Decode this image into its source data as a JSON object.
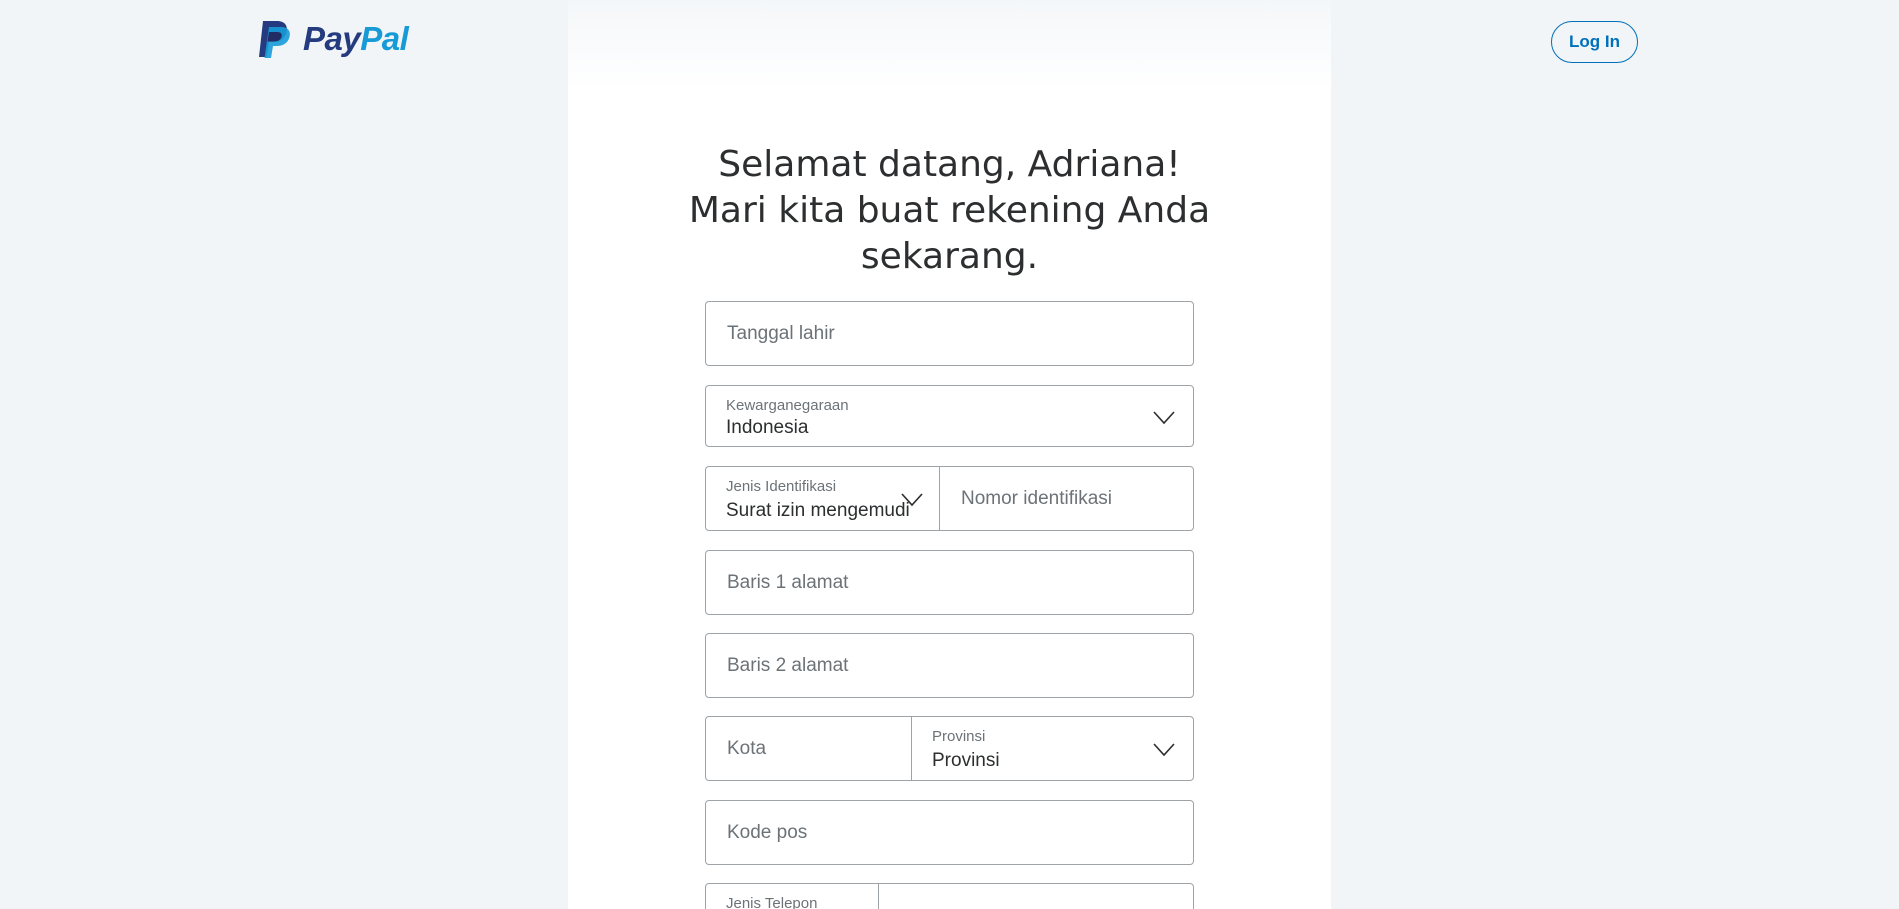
{
  "brand": {
    "name_part1": "Pay",
    "name_part2": "Pal",
    "colors": {
      "dark_blue": "#253b80",
      "light_blue": "#179bd7",
      "link_blue": "#0070ba"
    }
  },
  "header": {
    "login_label": "Log In"
  },
  "form": {
    "title_line1": "Selamat datang, Adriana!",
    "title_line2": "Mari kita buat rekening Anda",
    "title_line3": "sekarang.",
    "dob_placeholder": "Tanggal lahir",
    "citizenship_label": "Kewarganegaraan",
    "citizenship_value": "Indonesia",
    "id_type_label": "Jenis Identifikasi",
    "id_type_value": "Surat izin mengemudi",
    "id_number_placeholder": "Nomor identifikasi",
    "address1_placeholder": "Baris 1 alamat",
    "address2_placeholder": "Baris 2 alamat",
    "city_placeholder": "Kota",
    "province_label": "Provinsi",
    "province_value": "Provinsi",
    "postal_placeholder": "Kode pos",
    "phone_type_label": "Jenis Telepon"
  },
  "icons": {
    "logo": "paypal-logo-icon",
    "dropdown": "chevron-down-icon"
  }
}
